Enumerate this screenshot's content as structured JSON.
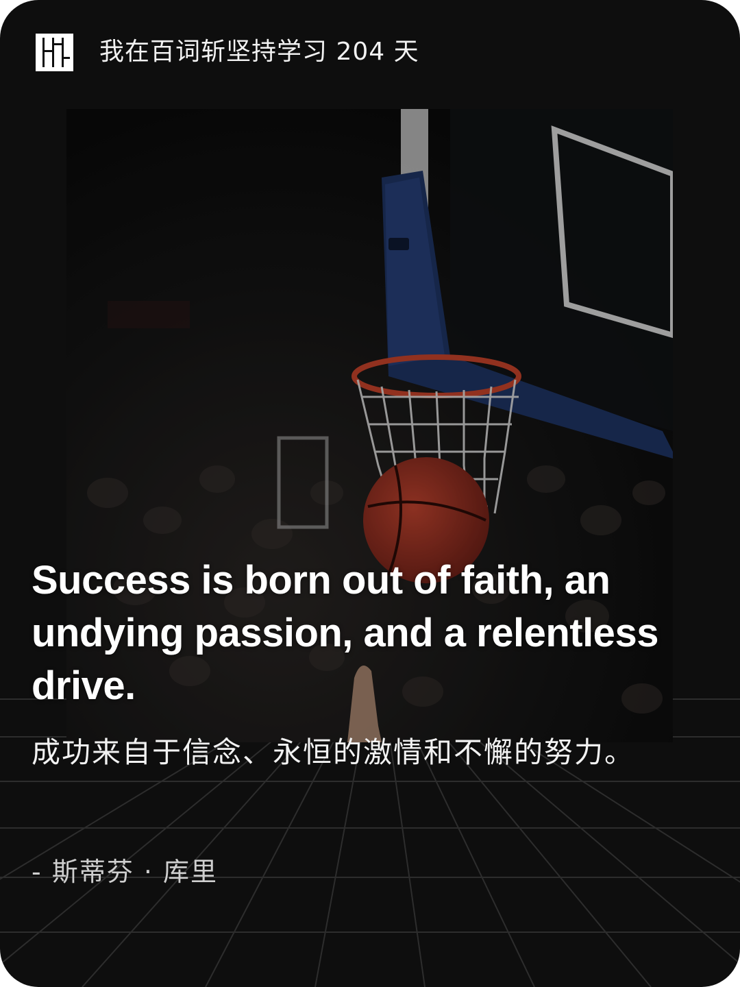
{
  "header": {
    "title": "我在百词斩坚持学习 204 天",
    "logo_icon": "baicizhan-logo-icon"
  },
  "photo": {
    "subject": "basketball-hoop-photo"
  },
  "quote": {
    "english": "Success is born out of faith, an undying passion, and a relentless drive.",
    "chinese": "成功来自于信念、永恒的激情和不懈的努力。",
    "author": "- 斯蒂芬 · 库里"
  },
  "colors": {
    "background": "#0e0e0e",
    "text_primary": "#ffffff",
    "text_secondary": "#cfcfcf",
    "backboard_frame": "#1f3566",
    "ball": "#9a2f23"
  }
}
